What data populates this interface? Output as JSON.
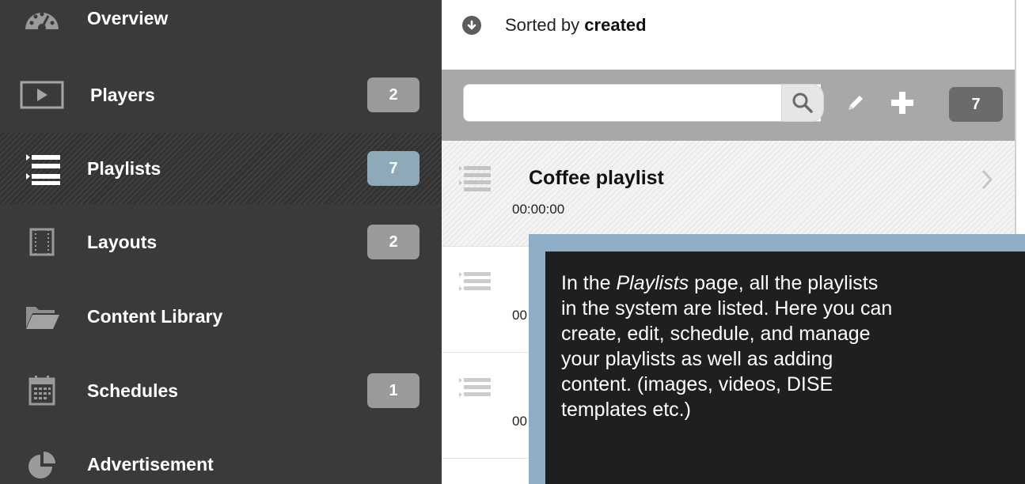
{
  "sidebar": {
    "items": [
      {
        "label": "Overview",
        "icon": "gauge-icon",
        "badge": null
      },
      {
        "label": "Players",
        "icon": "video-player-icon",
        "badge": "2"
      },
      {
        "label": "Playlists",
        "icon": "list-icon",
        "badge": "7",
        "active": true
      },
      {
        "label": "Layouts",
        "icon": "layout-icon",
        "badge": "2"
      },
      {
        "label": "Content Library",
        "icon": "folder-icon",
        "badge": null
      },
      {
        "label": "Schedules",
        "icon": "calendar-icon",
        "badge": "1"
      },
      {
        "label": "Advertisement",
        "icon": "pie-chart-icon",
        "badge": null
      }
    ],
    "colors": {
      "background": "#3a3a3a",
      "badge": "#9a9a9a",
      "badge_active": "#8eaab9"
    }
  },
  "main": {
    "sort": {
      "prefix": "Sorted by",
      "field": "created"
    },
    "toolbar": {
      "search_value": "",
      "search_placeholder": "",
      "count": "7"
    },
    "playlists": [
      {
        "title": "Coffee playlist",
        "duration": "00:00:00",
        "active": true
      },
      {
        "title": "",
        "duration": "00"
      },
      {
        "title": "",
        "duration": "00"
      }
    ]
  },
  "tooltip": {
    "line1_pre": "In the ",
    "line1_em": "Playlists",
    "line1_post": " page, all the playlists",
    "body": "in the system are listed. Here you can\ncreate, edit, schedule, and manage\nyour playlists as well as adding\ncontent. (images, videos, DISE\n templates etc.)",
    "colors": {
      "border": "#8eaec7",
      "background": "#1f1f1f"
    }
  }
}
